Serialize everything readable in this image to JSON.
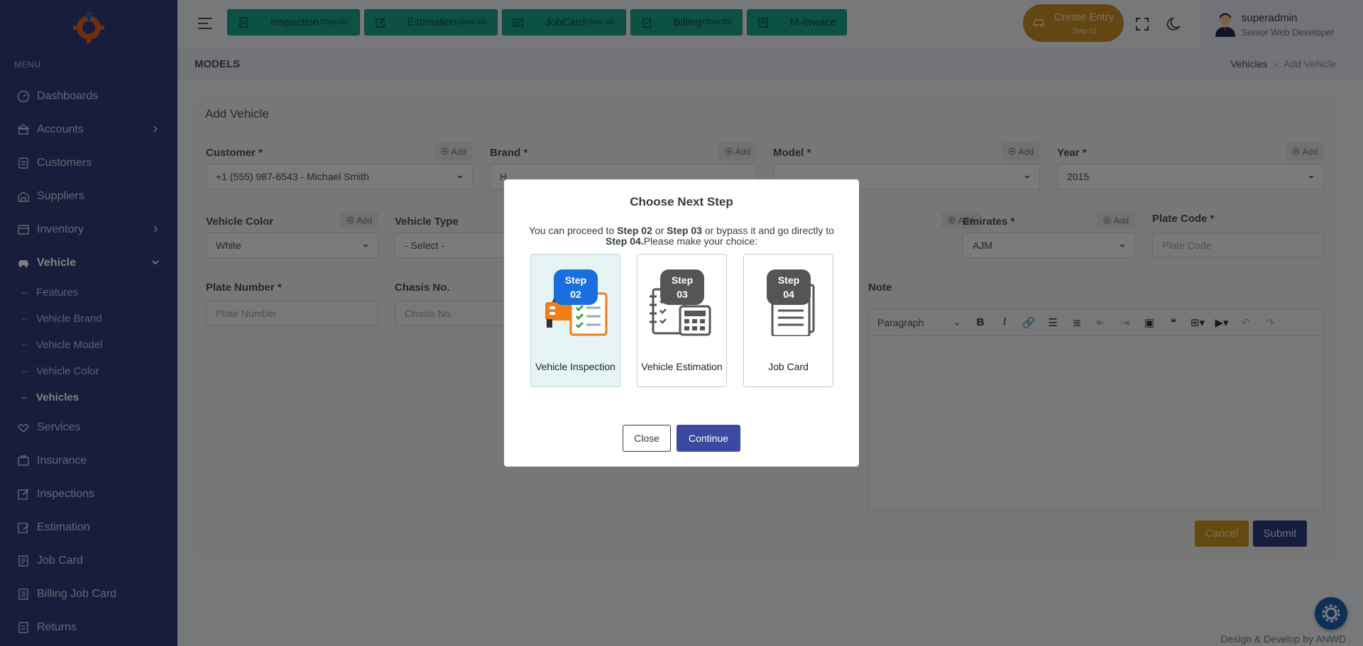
{
  "sidebar": {
    "menu_title": "MENU",
    "items": [
      {
        "label": "Dashboards",
        "icon": "dashboard-icon"
      },
      {
        "label": "Accounts",
        "icon": "bank-icon",
        "has_children": true
      },
      {
        "label": "Customers",
        "icon": "customers-icon"
      },
      {
        "label": "Suppliers",
        "icon": "suppliers-icon"
      },
      {
        "label": "Inventory",
        "icon": "inventory-icon",
        "has_children": true
      },
      {
        "label": "Vehicle",
        "icon": "car-icon",
        "expanded": true
      }
    ],
    "sub_items": [
      "Features",
      "Vehicle Brand",
      "Vehicle Model",
      "Vehicle Color",
      "Vehicles"
    ],
    "items_after": [
      {
        "label": "Services",
        "icon": "services-icon"
      },
      {
        "label": "Insurance",
        "icon": "insurance-icon"
      },
      {
        "label": "Inspections",
        "icon": "inspections-icon"
      },
      {
        "label": "Estimation",
        "icon": "estimation-icon"
      },
      {
        "label": "Job Card",
        "icon": "jobcard-icon"
      },
      {
        "label": "Billing Job Card",
        "icon": "billing-icon"
      },
      {
        "label": "Returns",
        "icon": "returns-icon"
      }
    ]
  },
  "topbar": {
    "steps": [
      {
        "label": "Inspection",
        "small": "(Step 02)"
      },
      {
        "label": "Estimation",
        "small": "(Step 03)"
      },
      {
        "label": "JobCard",
        "small": "(Step 04)"
      },
      {
        "label": "Billing",
        "small": "(Step 05)"
      },
      {
        "label": "M-Invoice",
        "small": ""
      }
    ],
    "create_entry": {
      "label": "Create Entry",
      "sub": "Step 01"
    },
    "user": {
      "name": "superadmin",
      "role": "Senior Web Developer"
    }
  },
  "page": {
    "title": "MODELS",
    "breadcrumb": [
      "Vehicles",
      "Add Vehicle"
    ]
  },
  "form": {
    "title": "Add Vehicle",
    "add_label": "Add",
    "customer": {
      "label": "Customer *",
      "value": "+1 (555) 987-6543 - Michael Smith"
    },
    "brand": {
      "label": "Brand *",
      "value": "H"
    },
    "model": {
      "label": "Model *",
      "value": ""
    },
    "year": {
      "label": "Year *",
      "value": "2015"
    },
    "color": {
      "label": "Vehicle Color",
      "value": "White"
    },
    "type": {
      "label": "Vehicle Type",
      "value": "- Select -"
    },
    "emirates": {
      "label": "Emirates *",
      "value": "AJM"
    },
    "plate_code": {
      "label": "Plate Code *",
      "placeholder": "Plate Code"
    },
    "plate_number": {
      "label": "Plate Number *",
      "placeholder": "Plate Number"
    },
    "chasis": {
      "label": "Chasis No.",
      "placeholder": "Chasis No."
    },
    "note": {
      "label": "Note",
      "toolbar_paragraph": "Paragraph"
    },
    "cancel": "Cancel",
    "submit": "Submit"
  },
  "footer": {
    "text": "Design & Develop by ANWD"
  },
  "modal": {
    "title": "Choose Next Step",
    "text_1": "You can proceed to ",
    "text_b1": "Step 02",
    "text_2": " or ",
    "text_b2": "Step 03",
    "text_3": " or bypass it and go directly to ",
    "text_b3": "Step 04.",
    "text_4": "Please make your choice:",
    "options": [
      {
        "badge_top": "Step",
        "badge_bottom": "02",
        "label": "Vehicle Inspection",
        "selected": true,
        "badge_color": "#1a6fe0"
      },
      {
        "badge_top": "Step",
        "badge_bottom": "03",
        "label": "Vehicle Estimation",
        "selected": false,
        "badge_color": "#555555"
      },
      {
        "badge_top": "Step",
        "badge_bottom": "04",
        "label": "Job Card",
        "selected": false,
        "badge_color": "#555555"
      }
    ],
    "close": "Close",
    "continue": "Continue"
  }
}
